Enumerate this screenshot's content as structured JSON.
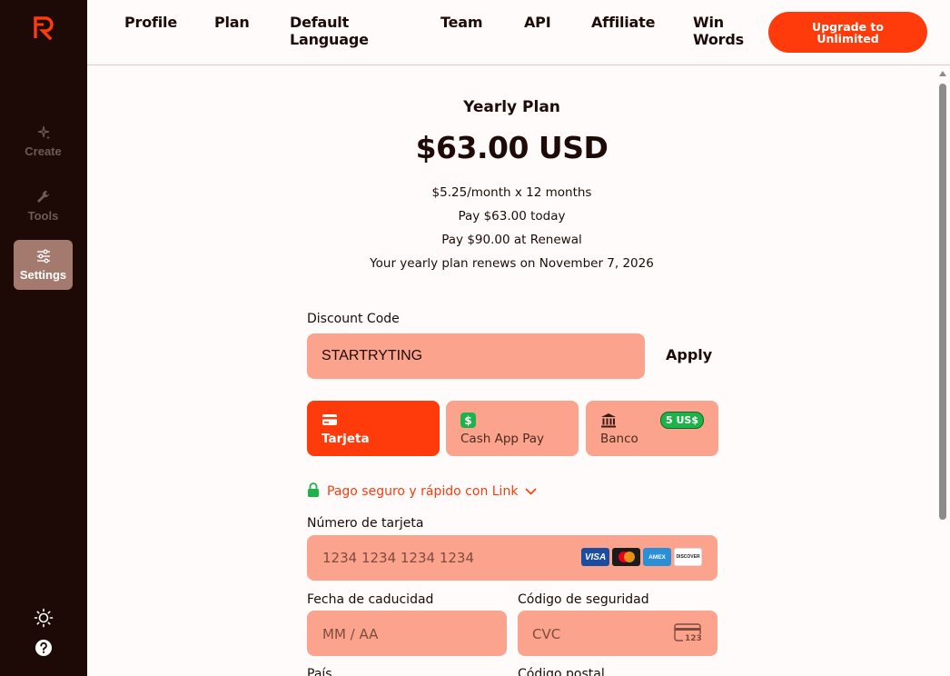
{
  "nav": {
    "items": [
      "Profile",
      "Plan",
      "Default Language",
      "Team",
      "API",
      "Affiliate",
      "Win Words"
    ],
    "upgrade_label": "Upgrade to Unlimited"
  },
  "sidebar": {
    "items": [
      {
        "label": "Create",
        "icon": "sparkles-icon"
      },
      {
        "label": "Tools",
        "icon": "wrench-icon"
      },
      {
        "label": "Settings",
        "icon": "sliders-icon",
        "active": true
      }
    ],
    "bottom_icons": [
      "sun-icon",
      "help-icon"
    ]
  },
  "plan": {
    "title": "Yearly Plan",
    "price": "$63.00 USD",
    "monthly": "$5.25/month x 12 months",
    "today": "Pay $63.00 today",
    "renewal": "Pay $90.00 at Renewal",
    "renews_on": "Your yearly plan renews on November 7, 2026"
  },
  "discount": {
    "label": "Discount Code",
    "value": "STARTRYTING",
    "apply_label": "Apply"
  },
  "payment_tabs": [
    {
      "label": "Tarjeta",
      "icon": "card-icon",
      "active": true
    },
    {
      "label": "Cash App Pay",
      "icon": "cashapp-icon"
    },
    {
      "label": "Banco",
      "icon": "bank-icon",
      "badge": "5 US$"
    }
  ],
  "link": {
    "label": "Pago seguro y rápido con Link"
  },
  "card": {
    "number_label": "Número de tarjeta",
    "number_placeholder": "1234 1234 1234 1234",
    "brands": [
      "VISA",
      "AMEX",
      "DISCOVER"
    ],
    "expiry_label": "Fecha de caducidad",
    "expiry_placeholder": "MM / AA",
    "cvc_label": "Código de seguridad",
    "cvc_placeholder": "CVC",
    "cvc_icon_text": "123",
    "country_label": "País",
    "postal_label": "Código postal"
  },
  "colors": {
    "accent": "#ff3a0b",
    "input_bg": "#fca38d",
    "sidebar_bg": "#1d0a06",
    "badge_green": "#1fb14a"
  }
}
